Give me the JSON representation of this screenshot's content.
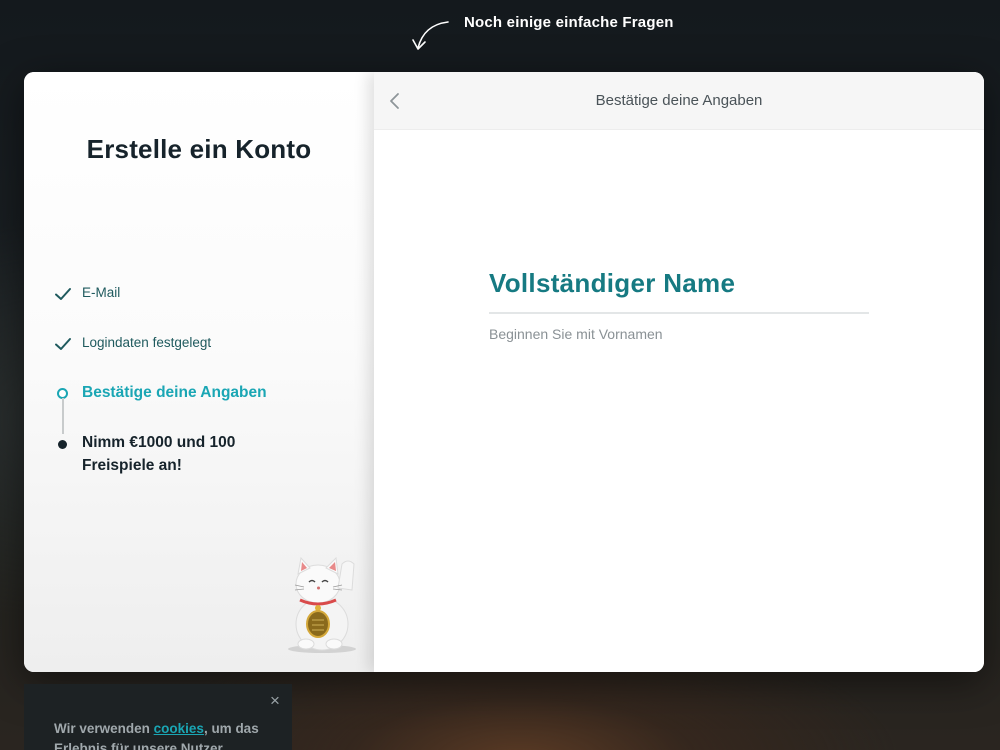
{
  "top_hint": {
    "text": "Noch einige einfache Fragen"
  },
  "left_panel": {
    "title": "Erstelle ein Konto",
    "steps": [
      {
        "label": "E-Mail",
        "state": "done"
      },
      {
        "label": "Logindaten festgelegt",
        "state": "done"
      },
      {
        "label": "Bestätige deine Angaben",
        "state": "current"
      },
      {
        "label": "Nimm €1000 und 100 Freispiele an!",
        "state": "upcoming"
      }
    ]
  },
  "right_panel": {
    "header_title": "Bestätige deine Angaben",
    "field_label": "Vollständiger Name",
    "field_value": "",
    "field_hint": "Beginnen Sie mit Vornamen"
  },
  "cookie_banner": {
    "text_before": "Wir verwenden ",
    "link_text": "cookies",
    "text_after": ", um das Erlebnis für unsere Nutzer",
    "close_symbol": "×"
  },
  "colors": {
    "accent": "#1aa6b4",
    "label_teal": "#167a82",
    "dark": "#16232b"
  },
  "icons": [
    "curved-arrow-icon",
    "check-icon",
    "chevron-left-icon",
    "close-icon",
    "lucky-cat-image"
  ]
}
